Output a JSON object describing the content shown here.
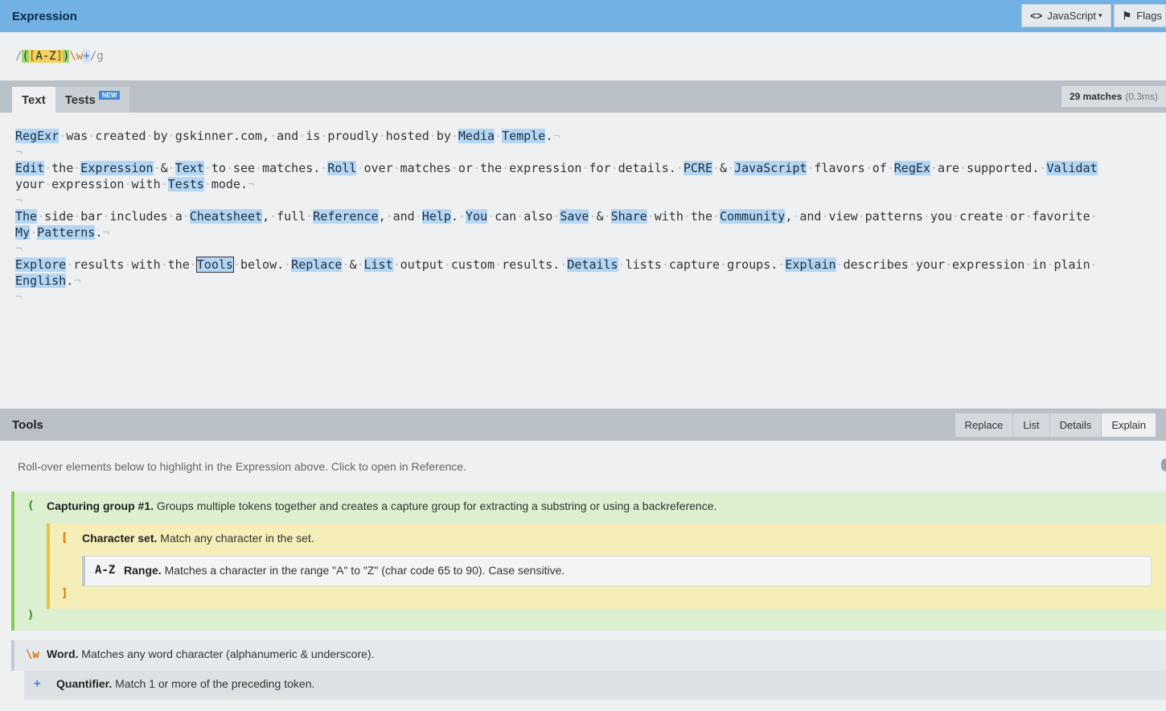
{
  "header": {
    "title": "Expression",
    "flavor_label": "JavaScript",
    "flags_label": "Flags"
  },
  "expression": {
    "open_delim": "/",
    "group_open": "(",
    "set_open": "[",
    "range": "A-Z",
    "set_close": "]",
    "group_close": ")",
    "word": "\\w",
    "quantifier": "+",
    "close_delim": "/",
    "flags": "g"
  },
  "text_panel": {
    "tab_text": "Text",
    "tab_tests": "Tests",
    "new_badge": "NEW",
    "match_count": "29 matches",
    "match_time": "(0.3ms)"
  },
  "sample_text": {
    "lines": [
      [
        [
          "RegExr",
          1
        ],
        [
          " ",
          0
        ],
        [
          "was",
          0
        ],
        [
          " ",
          0
        ],
        [
          "created",
          0
        ],
        [
          " ",
          0
        ],
        [
          "by",
          0
        ],
        [
          " ",
          0
        ],
        [
          "gskinner.com,",
          0
        ],
        [
          " ",
          0
        ],
        [
          "and",
          0
        ],
        [
          " ",
          0
        ],
        [
          "is",
          0
        ],
        [
          " ",
          0
        ],
        [
          "proudly",
          0
        ],
        [
          " ",
          0
        ],
        [
          "hosted",
          0
        ],
        [
          " ",
          0
        ],
        [
          "by",
          0
        ],
        [
          " ",
          0
        ],
        [
          "Media",
          1
        ],
        [
          " ",
          0
        ],
        [
          "Temple",
          1
        ],
        [
          ".",
          0
        ]
      ],
      [],
      [
        [
          "Edit",
          1
        ],
        [
          " ",
          0
        ],
        [
          "the",
          0
        ],
        [
          " ",
          0
        ],
        [
          "Expression",
          1
        ],
        [
          " ",
          0
        ],
        [
          "&",
          0
        ],
        [
          " ",
          0
        ],
        [
          "Text",
          1
        ],
        [
          " ",
          0
        ],
        [
          "to",
          0
        ],
        [
          " ",
          0
        ],
        [
          "see",
          0
        ],
        [
          " ",
          0
        ],
        [
          "matches.",
          0
        ],
        [
          " ",
          0
        ],
        [
          "Roll",
          1
        ],
        [
          " ",
          0
        ],
        [
          "over",
          0
        ],
        [
          " ",
          0
        ],
        [
          "matches",
          0
        ],
        [
          " ",
          0
        ],
        [
          "or",
          0
        ],
        [
          " ",
          0
        ],
        [
          "the",
          0
        ],
        [
          " ",
          0
        ],
        [
          "expression",
          0
        ],
        [
          " ",
          0
        ],
        [
          "for",
          0
        ],
        [
          " ",
          0
        ],
        [
          "details.",
          0
        ],
        [
          " ",
          0
        ],
        [
          "PCRE",
          1
        ],
        [
          " ",
          0
        ],
        [
          "&",
          0
        ],
        [
          " ",
          0
        ],
        [
          "JavaScript",
          1
        ],
        [
          " ",
          0
        ],
        [
          "flavors",
          0
        ],
        [
          " ",
          0
        ],
        [
          "of",
          0
        ],
        [
          " ",
          0
        ],
        [
          "RegEx",
          1
        ],
        [
          " ",
          0
        ],
        [
          "are",
          0
        ],
        [
          " ",
          0
        ],
        [
          "supported.",
          0
        ],
        [
          " ",
          0
        ],
        [
          "Validat",
          1
        ]
      ],
      [
        [
          "your",
          0
        ],
        [
          " ",
          0
        ],
        [
          "expression",
          0
        ],
        [
          " ",
          0
        ],
        [
          "with",
          0
        ],
        [
          " ",
          0
        ],
        [
          "Tests",
          1
        ],
        [
          " ",
          0
        ],
        [
          "mode.",
          0
        ]
      ],
      [],
      [
        [
          "The",
          1
        ],
        [
          " ",
          0
        ],
        [
          "side",
          0
        ],
        [
          " ",
          0
        ],
        [
          "bar",
          0
        ],
        [
          " ",
          0
        ],
        [
          "includes",
          0
        ],
        [
          " ",
          0
        ],
        [
          "a",
          0
        ],
        [
          " ",
          0
        ],
        [
          "Cheatsheet",
          1
        ],
        [
          ",",
          0
        ],
        [
          " ",
          0
        ],
        [
          "full",
          0
        ],
        [
          " ",
          0
        ],
        [
          "Reference",
          1
        ],
        [
          ",",
          0
        ],
        [
          " ",
          0
        ],
        [
          "and",
          0
        ],
        [
          " ",
          0
        ],
        [
          "Help",
          1
        ],
        [
          ".",
          0
        ],
        [
          " ",
          0
        ],
        [
          "You",
          1
        ],
        [
          " ",
          0
        ],
        [
          "can",
          0
        ],
        [
          " ",
          0
        ],
        [
          "also",
          0
        ],
        [
          " ",
          0
        ],
        [
          "Save",
          1
        ],
        [
          " ",
          0
        ],
        [
          "&",
          0
        ],
        [
          " ",
          0
        ],
        [
          "Share",
          1
        ],
        [
          " ",
          0
        ],
        [
          "with",
          0
        ],
        [
          " ",
          0
        ],
        [
          "the",
          0
        ],
        [
          " ",
          0
        ],
        [
          "Community",
          1
        ],
        [
          ",",
          0
        ],
        [
          " ",
          0
        ],
        [
          "and",
          0
        ],
        [
          " ",
          0
        ],
        [
          "view",
          0
        ],
        [
          " ",
          0
        ],
        [
          "patterns",
          0
        ],
        [
          " ",
          0
        ],
        [
          "you",
          0
        ],
        [
          " ",
          0
        ],
        [
          "create",
          0
        ],
        [
          " ",
          0
        ],
        [
          "or",
          0
        ],
        [
          " ",
          0
        ],
        [
          "favorite",
          0
        ],
        [
          " ",
          0
        ]
      ],
      [
        [
          "My",
          1
        ],
        [
          " ",
          0
        ],
        [
          "Patterns",
          1
        ],
        [
          ".",
          0
        ]
      ],
      [],
      [
        [
          "Explore",
          1
        ],
        [
          " ",
          0
        ],
        [
          "results",
          0
        ],
        [
          " ",
          0
        ],
        [
          "with",
          0
        ],
        [
          " ",
          0
        ],
        [
          "the",
          0
        ],
        [
          " ",
          0
        ],
        [
          "Tools",
          2
        ],
        [
          " ",
          0
        ],
        [
          "below.",
          0
        ],
        [
          " ",
          0
        ],
        [
          "Replace",
          1
        ],
        [
          " ",
          0
        ],
        [
          "&",
          0
        ],
        [
          " ",
          0
        ],
        [
          "List",
          1
        ],
        [
          " ",
          0
        ],
        [
          "output",
          0
        ],
        [
          " ",
          0
        ],
        [
          "custom",
          0
        ],
        [
          " ",
          0
        ],
        [
          "results.",
          0
        ],
        [
          " ",
          0
        ],
        [
          "Details",
          1
        ],
        [
          " ",
          0
        ],
        [
          "lists",
          0
        ],
        [
          " ",
          0
        ],
        [
          "capture",
          0
        ],
        [
          " ",
          0
        ],
        [
          "groups.",
          0
        ],
        [
          " ",
          0
        ],
        [
          "Explain",
          1
        ],
        [
          " ",
          0
        ],
        [
          "describes",
          0
        ],
        [
          " ",
          0
        ],
        [
          "your",
          0
        ],
        [
          " ",
          0
        ],
        [
          "expression",
          0
        ],
        [
          " ",
          0
        ],
        [
          "in",
          0
        ],
        [
          " ",
          0
        ],
        [
          "plain",
          0
        ],
        [
          " ",
          0
        ]
      ],
      [
        [
          "English",
          1
        ],
        [
          ".",
          0
        ]
      ],
      []
    ],
    "pilcrow": "¬",
    "space_glyph": "·"
  },
  "tools": {
    "title": "Tools",
    "tabs": [
      "Replace",
      "List",
      "Details",
      "Explain"
    ],
    "active_tab": "Explain",
    "hint": "Roll-over elements below to highlight in the Expression above. Click to open in Reference.",
    "nodes": {
      "group": {
        "token": "(",
        "close": ")",
        "title": "Capturing group #1.",
        "desc": "Groups multiple tokens together and creates a capture group for extracting a substring or using a backreference."
      },
      "set": {
        "token": "[",
        "close": "]",
        "title": "Character set.",
        "desc": "Match any character in the set."
      },
      "range": {
        "token": "A-Z",
        "title": "Range.",
        "desc": "Matches a character in the range \"A\" to \"Z\" (char code 65 to 90). Case sensitive."
      },
      "word": {
        "token": "\\w",
        "title": "Word.",
        "desc": "Matches any word character (alphanumeric & underscore)."
      },
      "quant": {
        "token": "+",
        "title": "Quantifier.",
        "desc": "Match 1 or more of the preceding token."
      }
    }
  },
  "colors": {
    "header_bg": "#71b1e3",
    "match_bg": "#b4d6f3",
    "group_bg": "#dcefd0",
    "set_bg": "#f5eeb8"
  }
}
